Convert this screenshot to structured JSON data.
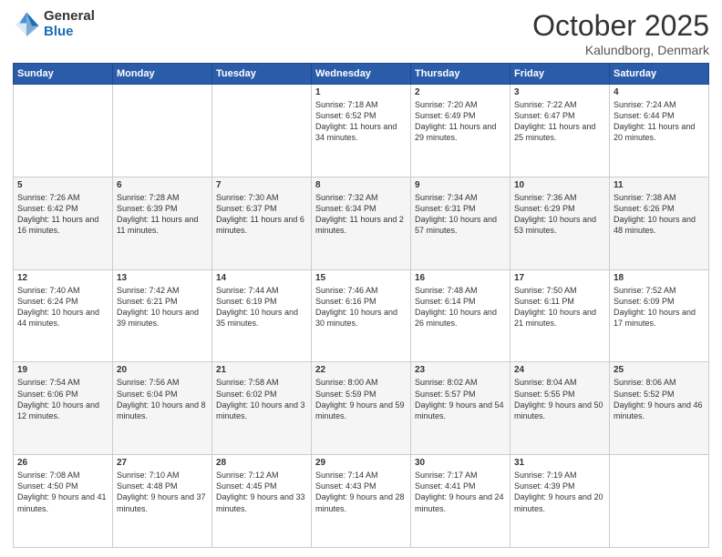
{
  "header": {
    "logo_general": "General",
    "logo_blue": "Blue",
    "month": "October 2025",
    "location": "Kalundborg, Denmark"
  },
  "days_of_week": [
    "Sunday",
    "Monday",
    "Tuesday",
    "Wednesday",
    "Thursday",
    "Friday",
    "Saturday"
  ],
  "weeks": [
    [
      {
        "day": "",
        "sunrise": "",
        "sunset": "",
        "daylight": ""
      },
      {
        "day": "",
        "sunrise": "",
        "sunset": "",
        "daylight": ""
      },
      {
        "day": "",
        "sunrise": "",
        "sunset": "",
        "daylight": ""
      },
      {
        "day": "1",
        "sunrise": "Sunrise: 7:18 AM",
        "sunset": "Sunset: 6:52 PM",
        "daylight": "Daylight: 11 hours and 34 minutes."
      },
      {
        "day": "2",
        "sunrise": "Sunrise: 7:20 AM",
        "sunset": "Sunset: 6:49 PM",
        "daylight": "Daylight: 11 hours and 29 minutes."
      },
      {
        "day": "3",
        "sunrise": "Sunrise: 7:22 AM",
        "sunset": "Sunset: 6:47 PM",
        "daylight": "Daylight: 11 hours and 25 minutes."
      },
      {
        "day": "4",
        "sunrise": "Sunrise: 7:24 AM",
        "sunset": "Sunset: 6:44 PM",
        "daylight": "Daylight: 11 hours and 20 minutes."
      }
    ],
    [
      {
        "day": "5",
        "sunrise": "Sunrise: 7:26 AM",
        "sunset": "Sunset: 6:42 PM",
        "daylight": "Daylight: 11 hours and 16 minutes."
      },
      {
        "day": "6",
        "sunrise": "Sunrise: 7:28 AM",
        "sunset": "Sunset: 6:39 PM",
        "daylight": "Daylight: 11 hours and 11 minutes."
      },
      {
        "day": "7",
        "sunrise": "Sunrise: 7:30 AM",
        "sunset": "Sunset: 6:37 PM",
        "daylight": "Daylight: 11 hours and 6 minutes."
      },
      {
        "day": "8",
        "sunrise": "Sunrise: 7:32 AM",
        "sunset": "Sunset: 6:34 PM",
        "daylight": "Daylight: 11 hours and 2 minutes."
      },
      {
        "day": "9",
        "sunrise": "Sunrise: 7:34 AM",
        "sunset": "Sunset: 6:31 PM",
        "daylight": "Daylight: 10 hours and 57 minutes."
      },
      {
        "day": "10",
        "sunrise": "Sunrise: 7:36 AM",
        "sunset": "Sunset: 6:29 PM",
        "daylight": "Daylight: 10 hours and 53 minutes."
      },
      {
        "day": "11",
        "sunrise": "Sunrise: 7:38 AM",
        "sunset": "Sunset: 6:26 PM",
        "daylight": "Daylight: 10 hours and 48 minutes."
      }
    ],
    [
      {
        "day": "12",
        "sunrise": "Sunrise: 7:40 AM",
        "sunset": "Sunset: 6:24 PM",
        "daylight": "Daylight: 10 hours and 44 minutes."
      },
      {
        "day": "13",
        "sunrise": "Sunrise: 7:42 AM",
        "sunset": "Sunset: 6:21 PM",
        "daylight": "Daylight: 10 hours and 39 minutes."
      },
      {
        "day": "14",
        "sunrise": "Sunrise: 7:44 AM",
        "sunset": "Sunset: 6:19 PM",
        "daylight": "Daylight: 10 hours and 35 minutes."
      },
      {
        "day": "15",
        "sunrise": "Sunrise: 7:46 AM",
        "sunset": "Sunset: 6:16 PM",
        "daylight": "Daylight: 10 hours and 30 minutes."
      },
      {
        "day": "16",
        "sunrise": "Sunrise: 7:48 AM",
        "sunset": "Sunset: 6:14 PM",
        "daylight": "Daylight: 10 hours and 26 minutes."
      },
      {
        "day": "17",
        "sunrise": "Sunrise: 7:50 AM",
        "sunset": "Sunset: 6:11 PM",
        "daylight": "Daylight: 10 hours and 21 minutes."
      },
      {
        "day": "18",
        "sunrise": "Sunrise: 7:52 AM",
        "sunset": "Sunset: 6:09 PM",
        "daylight": "Daylight: 10 hours and 17 minutes."
      }
    ],
    [
      {
        "day": "19",
        "sunrise": "Sunrise: 7:54 AM",
        "sunset": "Sunset: 6:06 PM",
        "daylight": "Daylight: 10 hours and 12 minutes."
      },
      {
        "day": "20",
        "sunrise": "Sunrise: 7:56 AM",
        "sunset": "Sunset: 6:04 PM",
        "daylight": "Daylight: 10 hours and 8 minutes."
      },
      {
        "day": "21",
        "sunrise": "Sunrise: 7:58 AM",
        "sunset": "Sunset: 6:02 PM",
        "daylight": "Daylight: 10 hours and 3 minutes."
      },
      {
        "day": "22",
        "sunrise": "Sunrise: 8:00 AM",
        "sunset": "Sunset: 5:59 PM",
        "daylight": "Daylight: 9 hours and 59 minutes."
      },
      {
        "day": "23",
        "sunrise": "Sunrise: 8:02 AM",
        "sunset": "Sunset: 5:57 PM",
        "daylight": "Daylight: 9 hours and 54 minutes."
      },
      {
        "day": "24",
        "sunrise": "Sunrise: 8:04 AM",
        "sunset": "Sunset: 5:55 PM",
        "daylight": "Daylight: 9 hours and 50 minutes."
      },
      {
        "day": "25",
        "sunrise": "Sunrise: 8:06 AM",
        "sunset": "Sunset: 5:52 PM",
        "daylight": "Daylight: 9 hours and 46 minutes."
      }
    ],
    [
      {
        "day": "26",
        "sunrise": "Sunrise: 7:08 AM",
        "sunset": "Sunset: 4:50 PM",
        "daylight": "Daylight: 9 hours and 41 minutes."
      },
      {
        "day": "27",
        "sunrise": "Sunrise: 7:10 AM",
        "sunset": "Sunset: 4:48 PM",
        "daylight": "Daylight: 9 hours and 37 minutes."
      },
      {
        "day": "28",
        "sunrise": "Sunrise: 7:12 AM",
        "sunset": "Sunset: 4:45 PM",
        "daylight": "Daylight: 9 hours and 33 minutes."
      },
      {
        "day": "29",
        "sunrise": "Sunrise: 7:14 AM",
        "sunset": "Sunset: 4:43 PM",
        "daylight": "Daylight: 9 hours and 28 minutes."
      },
      {
        "day": "30",
        "sunrise": "Sunrise: 7:17 AM",
        "sunset": "Sunset: 4:41 PM",
        "daylight": "Daylight: 9 hours and 24 minutes."
      },
      {
        "day": "31",
        "sunrise": "Sunrise: 7:19 AM",
        "sunset": "Sunset: 4:39 PM",
        "daylight": "Daylight: 9 hours and 20 minutes."
      },
      {
        "day": "",
        "sunrise": "",
        "sunset": "",
        "daylight": ""
      }
    ]
  ]
}
